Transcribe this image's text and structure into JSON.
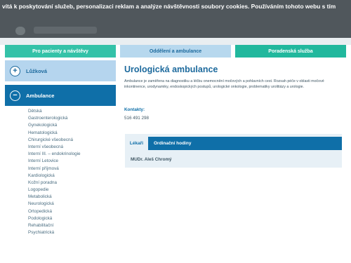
{
  "cookie_bar": {
    "text": "vítá k poskytování služeb, personalizaci reklam a analýze návštěvnosti soubory cookies. Používáním tohoto webu s tím"
  },
  "top_nav": {
    "tabs": [
      {
        "label": "Pro pacienty a návštěvy"
      },
      {
        "label": "Oddělení a ambulance"
      },
      {
        "label": "Poradenská služba"
      }
    ]
  },
  "sidebar": {
    "sections": [
      {
        "label": "Lůžková"
      },
      {
        "label": "Ambulance"
      }
    ],
    "items": [
      {
        "label": "Dětská"
      },
      {
        "label": "Gastroenterologická"
      },
      {
        "label": "Gynekologická"
      },
      {
        "label": "Hematologická"
      },
      {
        "label": "Chirurgické všeobecná"
      },
      {
        "label": "Interní všeobecná"
      },
      {
        "label": "Interní III. – endokrinologie"
      },
      {
        "label": "Interní Letovice"
      },
      {
        "label": "Interní příjmová"
      },
      {
        "label": "Kardiologická"
      },
      {
        "label": "Kožní poradna"
      },
      {
        "label": "Logopedie"
      },
      {
        "label": "Metabolická"
      },
      {
        "label": "Neurologická"
      },
      {
        "label": "Ortopedická"
      },
      {
        "label": "Podologická"
      },
      {
        "label": "Rehabilitační"
      },
      {
        "label": "Psychiatrická"
      }
    ]
  },
  "main": {
    "title": "Urologická ambulance",
    "description": "Ambulance je zaměřena na diagnostiku a léčbu onemocnění močových a pohlavních cest. Rozsah péče v oblasti močové inkontinence, urodynamiky, endoskopických postupů, urologické onkologie, problematiky urolitiázy a urologie.",
    "contacts_label": "Kontakty:",
    "contacts_value": "516 491 298",
    "tabs": [
      {
        "label": "Lékaři"
      },
      {
        "label": "Ordinační hodiny"
      }
    ],
    "doctor": "MUDr. Aleš Chromý"
  }
}
